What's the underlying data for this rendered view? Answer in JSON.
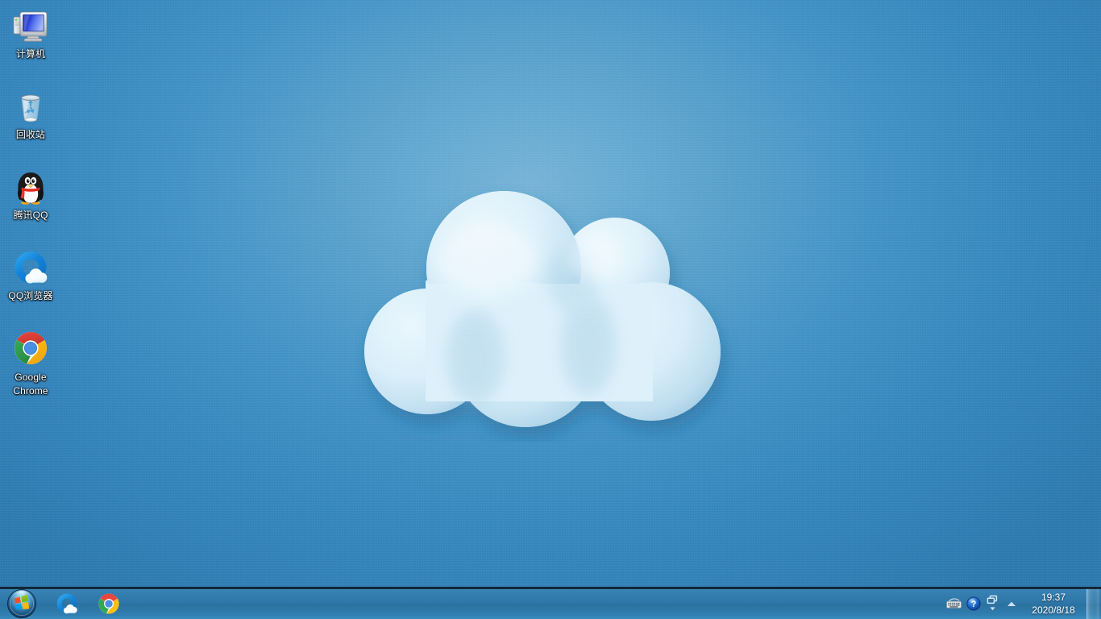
{
  "desktop": {
    "background_color": "#3385bd",
    "background_center_color": "#74b2d6",
    "wallpaper_name": "cloud-wallpaper",
    "wallpaper_cloud_color": "#d8ecf7"
  },
  "icons": [
    {
      "id": "computer",
      "label": "计算机",
      "icon": "computer-icon",
      "two_line": false
    },
    {
      "id": "recycle-bin",
      "label": "回收站",
      "icon": "recycle-bin-icon",
      "two_line": false
    },
    {
      "id": "tencent-qq",
      "label": "腾讯QQ",
      "icon": "qq-penguin-icon",
      "two_line": false
    },
    {
      "id": "qq-browser",
      "label": "QQ浏览器",
      "icon": "qq-browser-icon",
      "two_line": false
    },
    {
      "id": "google-chrome",
      "label": "Google Chrome",
      "icon": "chrome-icon",
      "two_line": true
    }
  ],
  "taskbar": {
    "start_label": "开始",
    "start_icon": "windows-start-orb-icon",
    "quicklaunch": [
      {
        "id": "qq-browser",
        "label": "QQ浏览器",
        "icon": "qq-browser-icon"
      },
      {
        "id": "chrome",
        "label": "Google Chrome",
        "icon": "chrome-icon"
      }
    ],
    "tray": [
      {
        "id": "ime",
        "label": "输入法",
        "icon": "keyboard-ime-icon"
      },
      {
        "id": "help",
        "label": "帮助",
        "icon": "help-question-icon"
      },
      {
        "id": "windows",
        "label": "窗口",
        "icon": "cascade-windows-icon"
      }
    ],
    "tray_expand": {
      "label": "显示隐藏的图标",
      "icon": "chevron-up-icon"
    },
    "clock": {
      "time": "19:37",
      "date": "2020/8/18"
    },
    "show_desktop": {
      "label": "显示桌面"
    }
  },
  "colors": {
    "taskbar_top": "#3a86b8",
    "taskbar_mid": "#2b719f",
    "accent": "#1e6fa8",
    "text_on_desktop": "#ffffff"
  }
}
